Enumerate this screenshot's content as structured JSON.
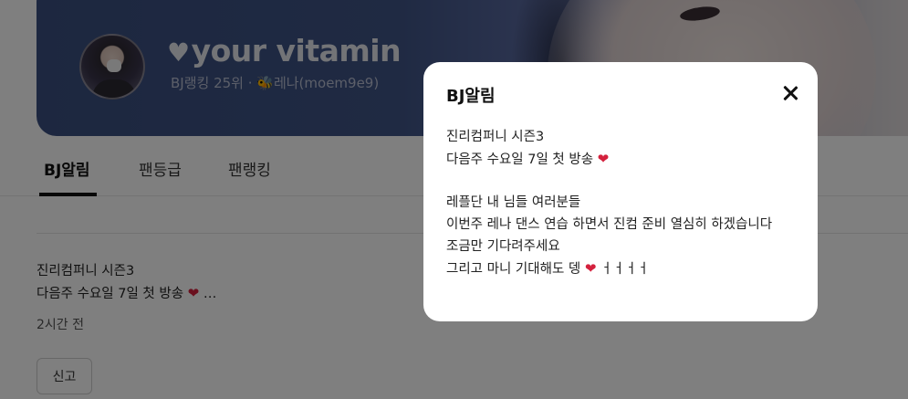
{
  "profile": {
    "nickname": "your vitamin",
    "heart_symbol": "♥",
    "sub_info": "BJ랭킹 25위 · 🐝레나(moem9e9)"
  },
  "tabs": [
    {
      "label": "BJ알림",
      "active": true
    },
    {
      "label": "팬등급",
      "active": false
    },
    {
      "label": "팬랭킹",
      "active": false
    }
  ],
  "post": {
    "line1": "진리컴퍼니 시즌3",
    "line2_text": "다음주 수요일 7일 첫 방송",
    "line2_heart": "❤",
    "line2_more": "…",
    "time": "2시간 전",
    "report_label": "신고"
  },
  "modal": {
    "title": "BJ알림",
    "lines": [
      {
        "text": "진리컴퍼니 시즌3",
        "heart": ""
      },
      {
        "text": "다음주 수요일 7일 첫 방송",
        "heart": "❤"
      },
      {
        "text": "",
        "heart": ""
      },
      {
        "text": "레플단 내 님들 여러분들",
        "heart": ""
      },
      {
        "text": "이번주 레나 댄스 연습 하면서 진컴 준비 열심히 하겠습니다",
        "heart": ""
      },
      {
        "text": "조금만 기다려주세요",
        "heart": ""
      },
      {
        "text": "그리고 마니 기대해도 뎅",
        "heart": "❤",
        "suffix": "ㅓㅓㅓㅓ"
      }
    ]
  },
  "colors": {
    "overlay": "rgba(0,0,0,0.5)",
    "heart": "#d4213d",
    "banner": "#3f5486"
  }
}
